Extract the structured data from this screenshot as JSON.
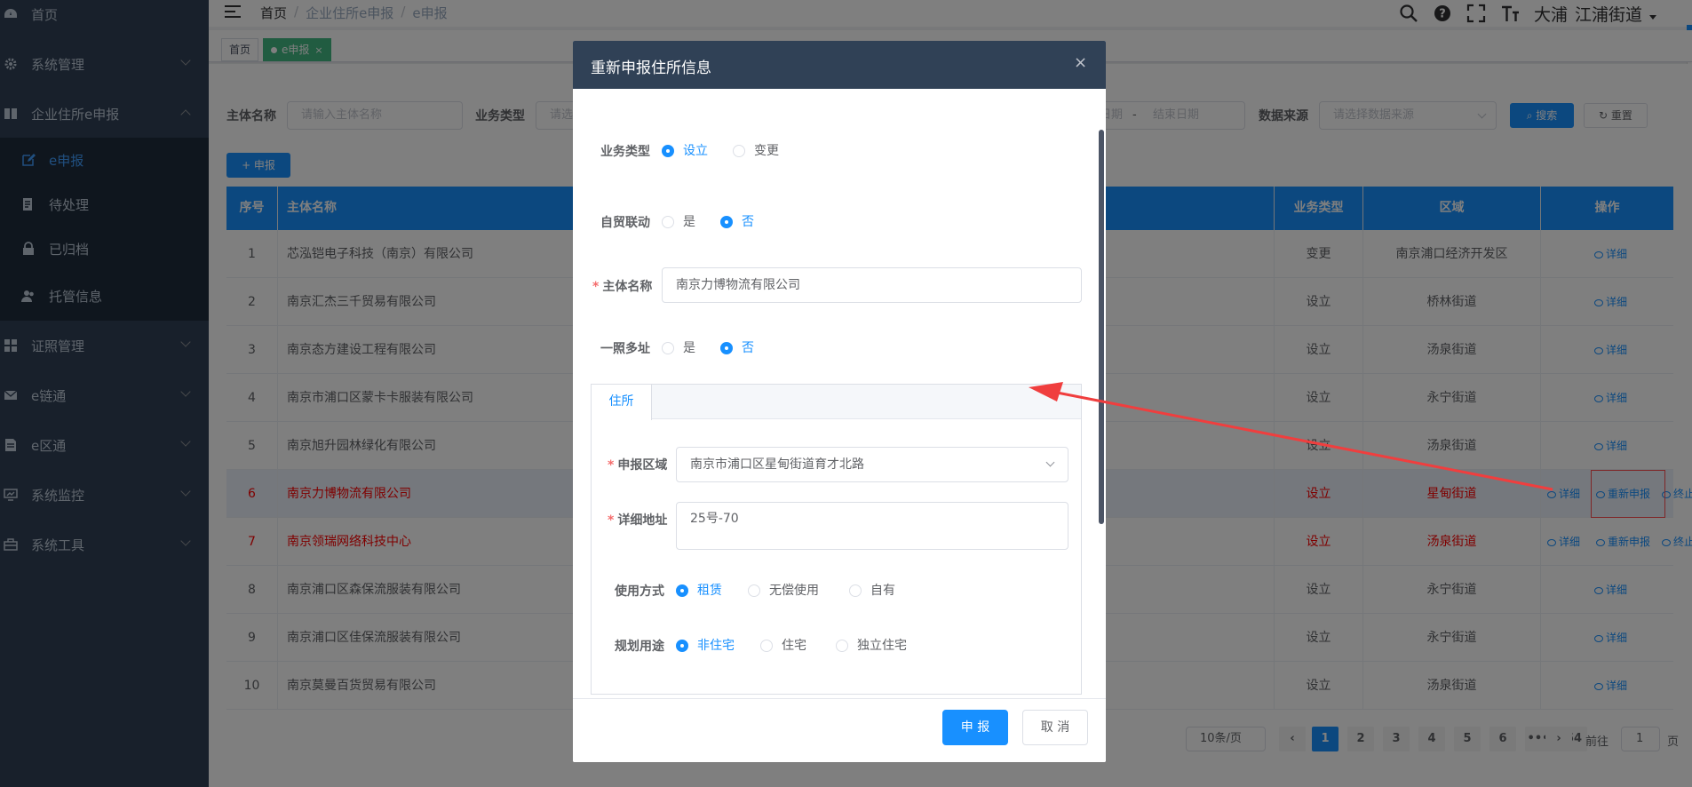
{
  "sidebar": {
    "items": [
      {
        "label": "首页",
        "icon": "dashboard-icon"
      },
      {
        "label": "系统管理",
        "icon": "gear-icon"
      },
      {
        "label": "企业住所e申报",
        "icon": "book-icon"
      },
      {
        "label": "证照管理",
        "icon": "grid-icon"
      },
      {
        "label": "e链通",
        "icon": "mail-icon"
      },
      {
        "label": "e区通",
        "icon": "document-icon"
      },
      {
        "label": "系统监控",
        "icon": "monitor-icon"
      },
      {
        "label": "系统工具",
        "icon": "toolbox-icon"
      }
    ],
    "subitems": [
      {
        "label": "e申报",
        "icon": "edit-icon"
      },
      {
        "label": "待处理",
        "icon": "list-icon"
      },
      {
        "label": "已归档",
        "icon": "lock-icon"
      },
      {
        "label": "托管信息",
        "icon": "people-icon"
      }
    ]
  },
  "topbar": {
    "breadcrumb": [
      "首页",
      "企业住所e申报",
      "e申报"
    ],
    "user": "大浦",
    "street": "江浦街道"
  },
  "tags": {
    "home": "首页",
    "active": "e申报"
  },
  "search": {
    "name_label": "主体名称",
    "name_placeholder": "请输入主体名称",
    "type_label": "业务类型",
    "type_placeholder": "请选",
    "start_placeholder": "日期",
    "range_sep": "-",
    "end_placeholder": "结束日期",
    "source_label": "数据来源",
    "source_placeholder": "请选择数据来源",
    "search_btn": "搜索",
    "reset_btn": "重置",
    "add_btn": "+ 申报"
  },
  "table": {
    "headers": {
      "index": "序号",
      "name": "主体名称",
      "type": "业务类型",
      "area": "区域",
      "ops": "操作"
    },
    "ops": {
      "detail": "详细",
      "redeclare": "重新申报",
      "terminate": "终止"
    },
    "rows": [
      {
        "index": "1",
        "name": "芯泓铠电子科技（南京）有限公司",
        "type": "变更",
        "area": "南京浦口经济开发区"
      },
      {
        "index": "2",
        "name": "南京汇杰三千贸易有限公司",
        "type": "设立",
        "area": "桥林街道"
      },
      {
        "index": "3",
        "name": "南京态方建设工程有限公司",
        "type": "设立",
        "area": "汤泉街道"
      },
      {
        "index": "4",
        "name": "南京市浦口区蒙卡卡服装有限公司",
        "type": "设立",
        "area": "永宁街道"
      },
      {
        "index": "5",
        "name": "南京旭升园林绿化有限公司",
        "type": "设立",
        "area": "汤泉街道"
      },
      {
        "index": "6",
        "name": "南京力博物流有限公司",
        "type": "设立",
        "area": "星甸街道"
      },
      {
        "index": "7",
        "name": "南京领瑞网络科技中心",
        "type": "设立",
        "area": "汤泉街道"
      },
      {
        "index": "8",
        "name": "南京浦口区森保流服装有限公司",
        "type": "设立",
        "area": "永宁街道"
      },
      {
        "index": "9",
        "name": "南京浦口区佳保流服装有限公司",
        "type": "设立",
        "area": "永宁街道"
      },
      {
        "index": "10",
        "name": "南京莫曼百货贸易有限公司",
        "type": "设立",
        "area": "汤泉街道"
      }
    ]
  },
  "pagination": {
    "page_size": "10条/页",
    "pages": [
      "1",
      "2",
      "3",
      "4",
      "5",
      "6",
      "•••",
      "54"
    ],
    "goto_label": "前往",
    "goto_value": "1",
    "goto_unit": "页"
  },
  "dialog": {
    "title": "重新申报住所信息",
    "business_type_label": "业务类型",
    "business_type_options": [
      "设立",
      "变更"
    ],
    "ftz_label": "自贸联动",
    "ftz_options": [
      "是",
      "否"
    ],
    "entity_name_label": "主体名称",
    "entity_name_value": "南京力博物流有限公司",
    "multi_addr_label": "一照多址",
    "multi_addr_options": [
      "是",
      "否"
    ],
    "tab_label": "住所",
    "region_label": "申报区域",
    "region_value": "南京市浦口区星甸街道育才北路",
    "address_label": "详细地址",
    "address_value": "25号-70",
    "usage_label": "使用方式",
    "usage_options": [
      "租赁",
      "无偿使用",
      "自有"
    ],
    "planning_label": "规划用途",
    "planning_options": [
      "非住宅",
      "住宅",
      "独立住宅"
    ],
    "submit_btn": "申 报",
    "cancel_btn": "取 消"
  },
  "colors": {
    "primary": "#1890ff",
    "sidebar": "#304156",
    "highlight_text": "#ff0000",
    "annotation_arrow": "#f03e3e"
  }
}
